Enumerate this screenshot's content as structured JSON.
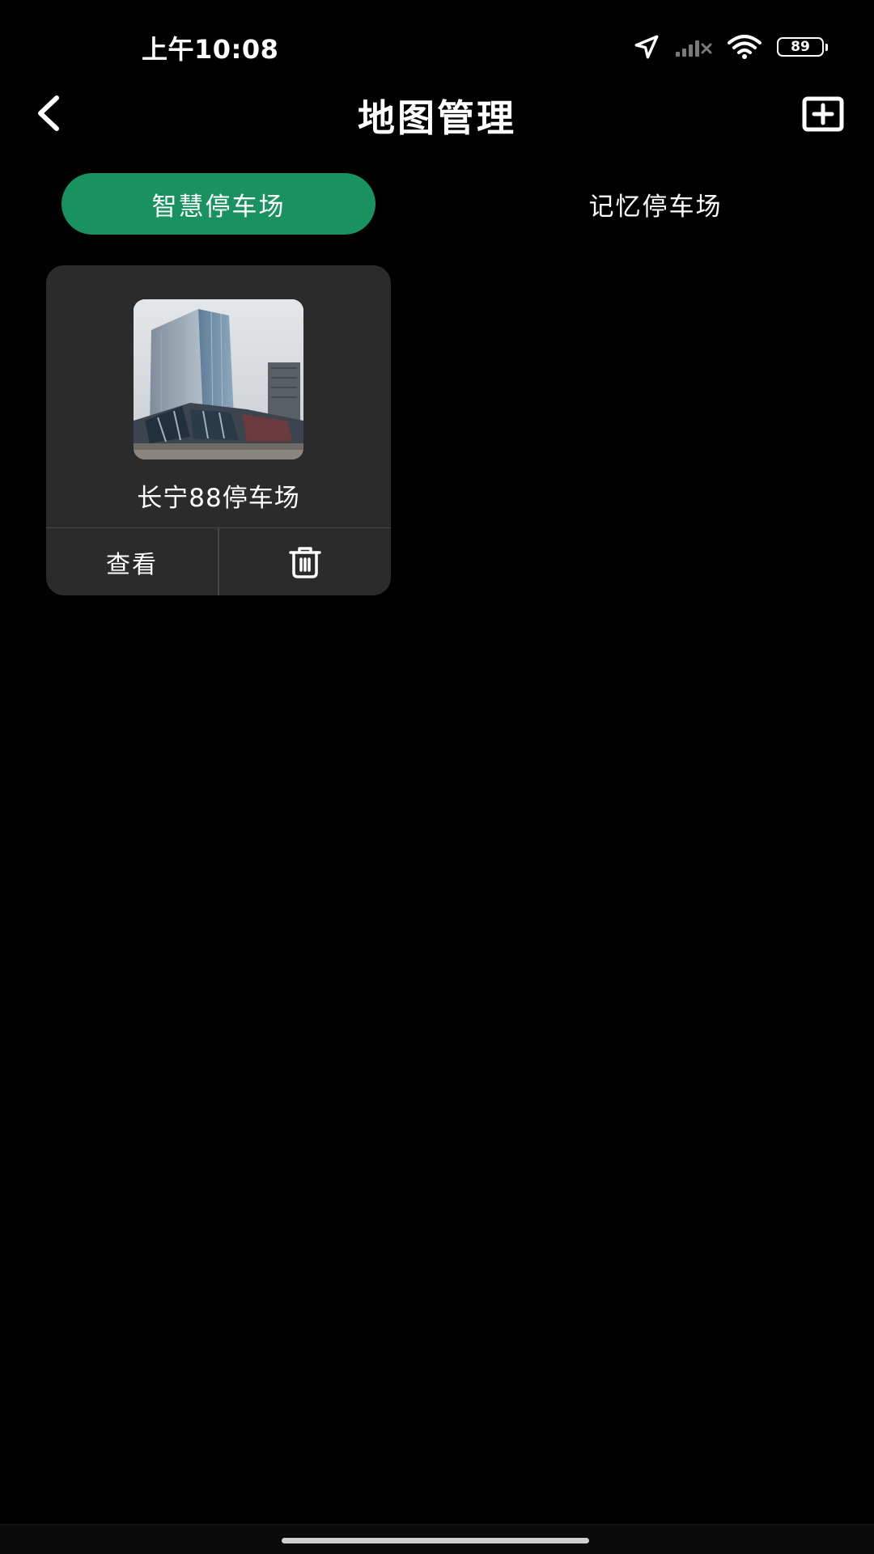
{
  "status_bar": {
    "time": "上午10:08",
    "battery": "89",
    "icons": [
      "location-arrow-icon",
      "cellular-signal-off-icon",
      "wifi-icon",
      "battery-icon"
    ]
  },
  "nav": {
    "title": "地图管理",
    "back_icon": "chevron-left-icon",
    "add_icon": "plus-square-icon"
  },
  "tabs": [
    {
      "label": "智慧停车场",
      "active": true
    },
    {
      "label": "记忆停车场",
      "active": false
    }
  ],
  "parking_lots": [
    {
      "name": "长宁88停车场",
      "image": "building-photo",
      "view_label": "查看",
      "delete_icon": "trash-icon"
    }
  ],
  "colors": {
    "background": "#000000",
    "accent": "#1a9160",
    "card": "#2b2b2b",
    "text": "#ffffff"
  }
}
